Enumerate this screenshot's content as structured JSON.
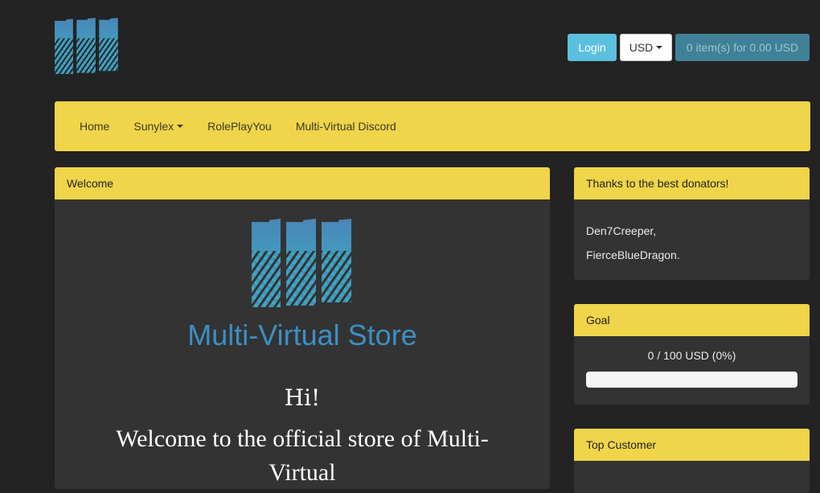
{
  "header": {
    "login_label": "Login",
    "currency_label": "USD",
    "cart_label": "0 item(s) for 0.00 USD"
  },
  "nav": {
    "items": [
      {
        "label": "Home"
      },
      {
        "label": "Sunylex"
      },
      {
        "label": "RolePlayYou"
      },
      {
        "label": "Multi-Virtual Discord"
      }
    ]
  },
  "main": {
    "heading": "Welcome",
    "store_title": "Multi-Virtual Store",
    "greeting": "Hi!",
    "welcome_text": "Welcome to the official store of Multi-Virtual"
  },
  "sidebar": {
    "donators": {
      "heading": "Thanks to the best donators!",
      "names": [
        "Den7Creeper,",
        "FierceBlueDragon."
      ]
    },
    "goal": {
      "heading": "Goal",
      "text": "0 / 100 USD (0%)",
      "progress": 0
    },
    "top_customer": {
      "heading": "Top Customer"
    }
  },
  "colors": {
    "accent_yellow": "#f0d44a",
    "brand_blue": "#3d8fc4",
    "login_blue": "#5bc0de",
    "cart_blue": "#3f8198",
    "background": "#232323",
    "panel": "#333333"
  },
  "icons": {
    "logo": "multi-virtual-logo-icon",
    "caret": "caret-down-icon"
  }
}
